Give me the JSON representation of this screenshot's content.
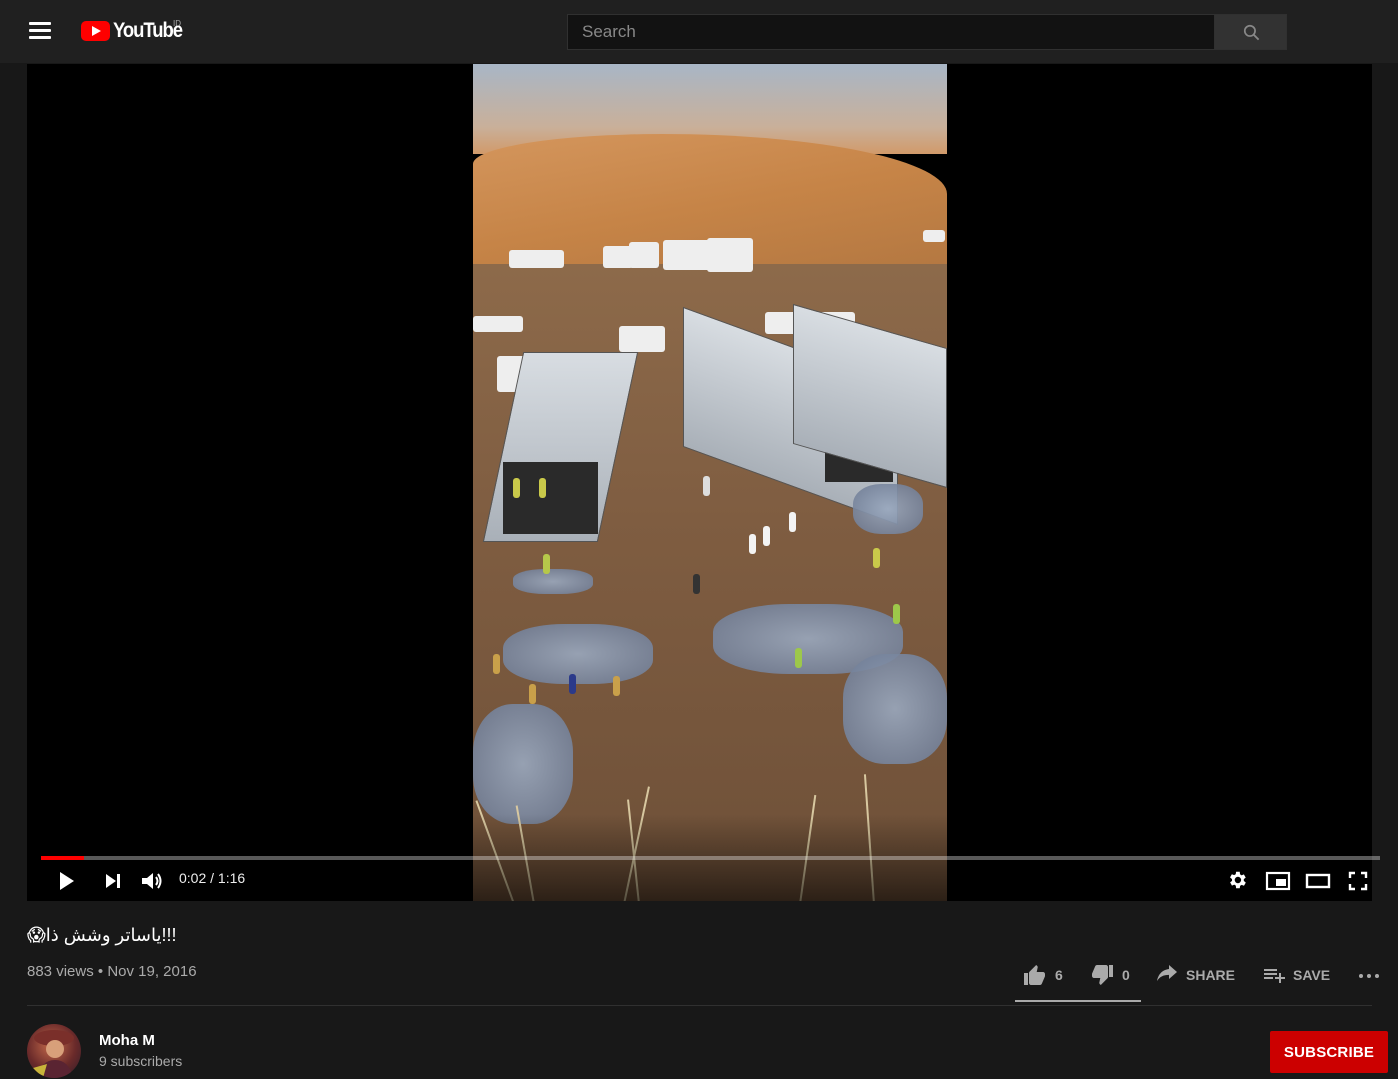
{
  "masthead": {
    "logo_text": "YouTube",
    "region": "ID",
    "search_placeholder": "Search"
  },
  "player": {
    "current_time": "0:02",
    "duration": "1:16",
    "time_display": "0:02 / 1:16",
    "progress_fraction": 0.032
  },
  "video": {
    "title": "😱ياساتر وشش ذا!!!",
    "views": "883 views",
    "separator": "•",
    "date": "Nov 19, 2016",
    "likes": "6",
    "dislikes": "0",
    "share_label": "SHARE",
    "save_label": "SAVE"
  },
  "channel": {
    "name": "Moha M",
    "subscribers": "9 subscribers",
    "subscribe_label": "SUBSCRIBE"
  },
  "colors": {
    "accent": "#ff0000",
    "subscribe": "#cc0000",
    "background": "#181818",
    "masthead": "#202020"
  }
}
